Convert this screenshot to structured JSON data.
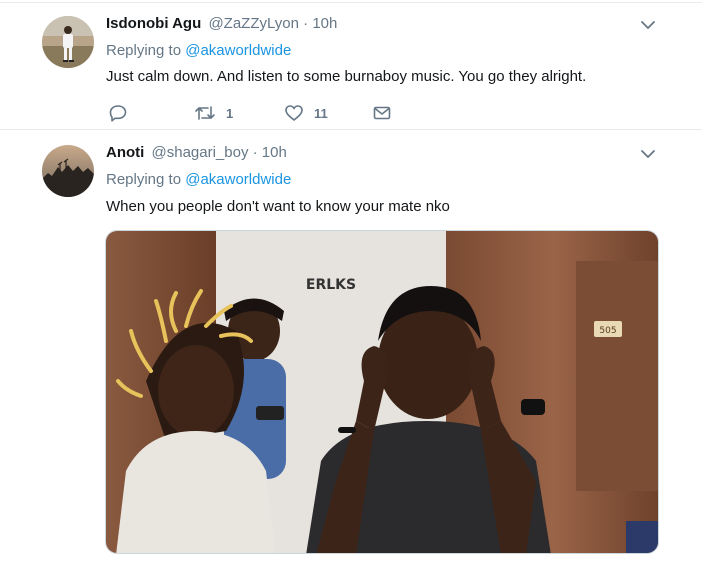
{
  "tweets": [
    {
      "name": "Isdonobi Agu",
      "handle": "@ZaZZyLyon",
      "separator": "·",
      "time": "10h",
      "replying_prefix": "Replying to",
      "replying_to": "@akaworldwide",
      "text": "Just calm down. And listen to some burnaboy music. You go they alright.",
      "actions": {
        "reply_icon": "reply-icon",
        "retweet_icon": "retweet-icon",
        "retweet_count": "1",
        "like_icon": "heart-icon",
        "like_count": "11",
        "dm_icon": "envelope-icon"
      }
    },
    {
      "name": "Anoti",
      "handle": "@shagari_boy",
      "separator": "·",
      "time": "10h",
      "replying_prefix": "Replying to",
      "replying_to": "@akaworldwide",
      "text": "When you people don't want to know your mate nko",
      "media": {
        "wall_logo": "ERLKS",
        "door_sign": "505"
      }
    }
  ],
  "colors": {
    "link": "#1b95e0",
    "secondary": "#657786",
    "divider": "#e6ecf0"
  }
}
